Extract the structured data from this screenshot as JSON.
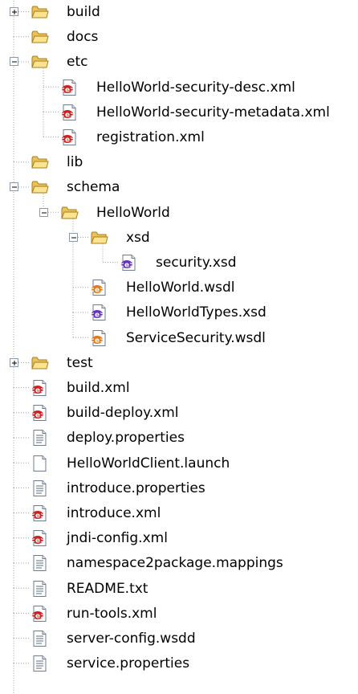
{
  "tree": {
    "items": [
      {
        "label": "build",
        "icon": "folder-icon",
        "expander": "plus",
        "depth": 0
      },
      {
        "label": "docs",
        "icon": "folder-icon",
        "expander": "none",
        "depth": 0
      },
      {
        "label": "etc",
        "icon": "folder-icon",
        "expander": "minus",
        "depth": 0
      },
      {
        "label": "HelloWorld-security-desc.xml",
        "icon": "xml-file-icon",
        "expander": "none",
        "depth": 1
      },
      {
        "label": "HelloWorld-security-metadata.xml",
        "icon": "xml-file-icon",
        "expander": "none",
        "depth": 1
      },
      {
        "label": "registration.xml",
        "icon": "xml-file-icon",
        "expander": "none",
        "depth": 1
      },
      {
        "label": "lib",
        "icon": "folder-icon",
        "expander": "none",
        "depth": 0
      },
      {
        "label": "schema",
        "icon": "folder-icon",
        "expander": "minus",
        "depth": 0
      },
      {
        "label": "HelloWorld",
        "icon": "folder-icon",
        "expander": "minus",
        "depth": 1
      },
      {
        "label": "xsd",
        "icon": "folder-icon",
        "expander": "minus",
        "depth": 2
      },
      {
        "label": "security.xsd",
        "icon": "xsd-file-icon",
        "expander": "none",
        "depth": 3
      },
      {
        "label": "HelloWorld.wsdl",
        "icon": "wsdl-file-icon",
        "expander": "none",
        "depth": 2
      },
      {
        "label": "HelloWorldTypes.xsd",
        "icon": "xsd-file-icon",
        "expander": "none",
        "depth": 2
      },
      {
        "label": "ServiceSecurity.wsdl",
        "icon": "wsdl-file-icon",
        "expander": "none",
        "depth": 2
      },
      {
        "label": "test",
        "icon": "folder-icon",
        "expander": "plus",
        "depth": 0
      },
      {
        "label": "build.xml",
        "icon": "xml-file-icon",
        "expander": "none",
        "depth": 0
      },
      {
        "label": "build-deploy.xml",
        "icon": "xml-file-icon",
        "expander": "none",
        "depth": 0
      },
      {
        "label": "deploy.properties",
        "icon": "text-file-icon",
        "expander": "none",
        "depth": 0
      },
      {
        "label": "HelloWorldClient.launch",
        "icon": "blank-file-icon",
        "expander": "none",
        "depth": 0
      },
      {
        "label": "introduce.properties",
        "icon": "text-file-icon",
        "expander": "none",
        "depth": 0
      },
      {
        "label": "introduce.xml",
        "icon": "xml-file-icon",
        "expander": "none",
        "depth": 0
      },
      {
        "label": "jndi-config.xml",
        "icon": "xml-file-icon",
        "expander": "none",
        "depth": 0
      },
      {
        "label": "namespace2package.mappings",
        "icon": "text-file-icon",
        "expander": "none",
        "depth": 0
      },
      {
        "label": "README.txt",
        "icon": "text-file-icon",
        "expander": "none",
        "depth": 0
      },
      {
        "label": "run-tools.xml",
        "icon": "xml-file-icon",
        "expander": "none",
        "depth": 0
      },
      {
        "label": "server-config.wsdd",
        "icon": "text-file-icon",
        "expander": "none",
        "depth": 0
      },
      {
        "label": "service.properties",
        "icon": "text-file-icon",
        "expander": "none",
        "depth": 0
      }
    ]
  }
}
